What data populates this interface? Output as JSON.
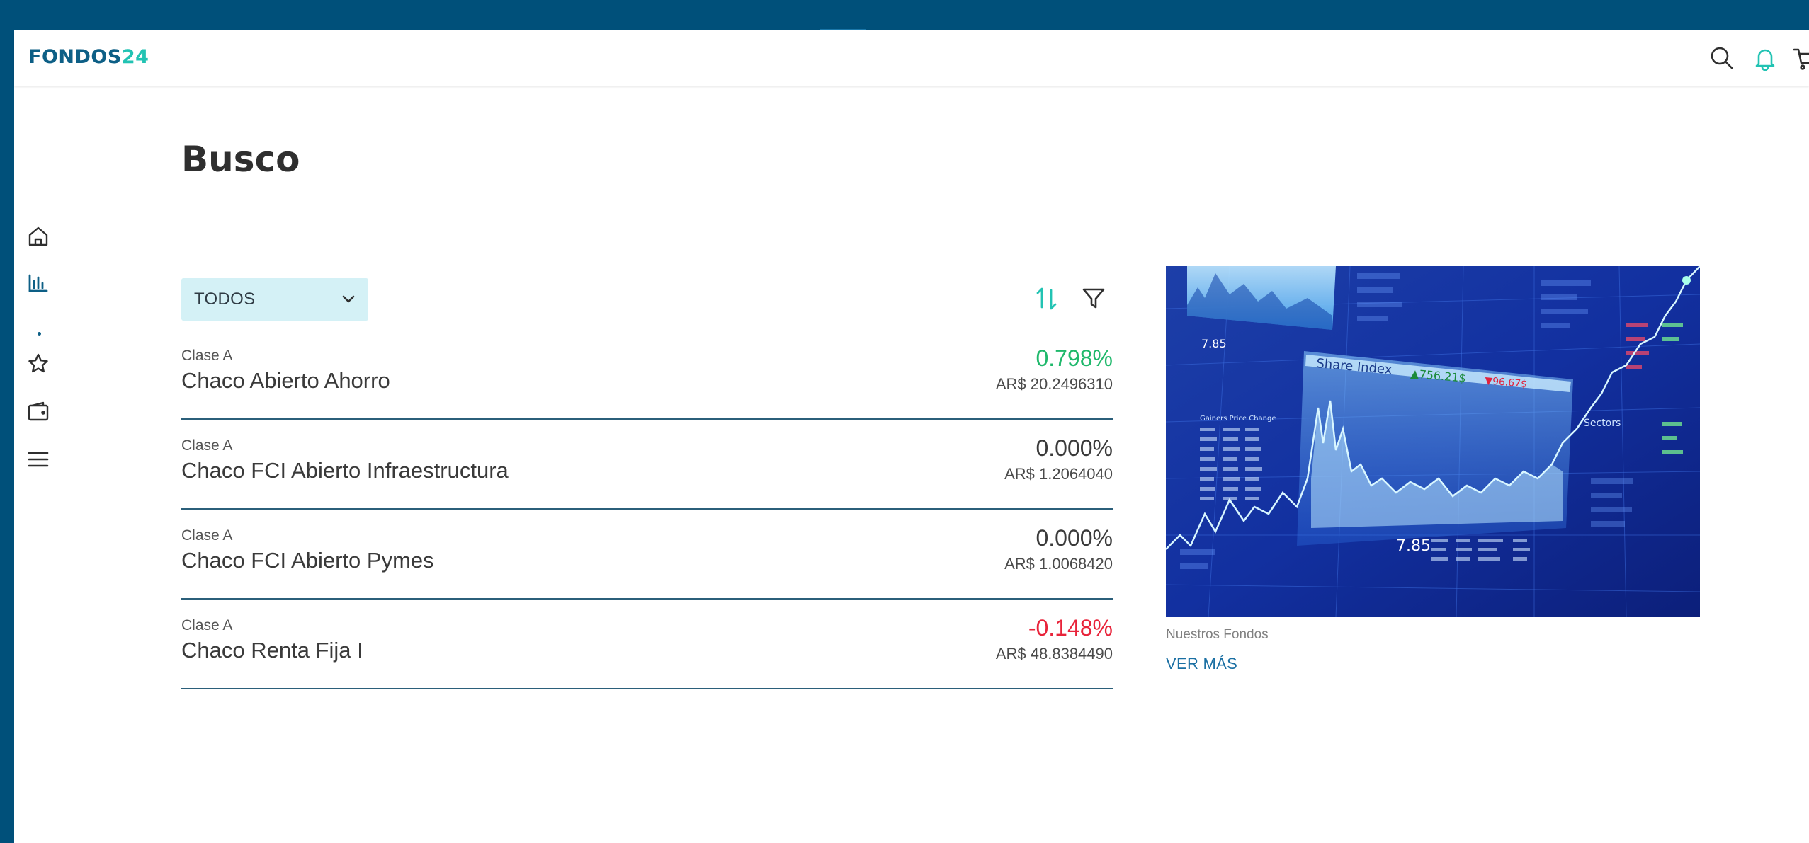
{
  "header": {
    "logo_part1": "FONDOS",
    "logo_part2": "24",
    "icons": [
      "search-icon",
      "bell-icon",
      "cart-icon"
    ]
  },
  "sidebar": {
    "items": [
      {
        "icon": "home-icon",
        "active": false
      },
      {
        "icon": "chart-icon",
        "active": true
      },
      {
        "icon": "star-icon",
        "active": false
      },
      {
        "icon": "wallet-icon",
        "active": false
      },
      {
        "icon": "menu-icon",
        "active": false
      }
    ]
  },
  "main": {
    "title": "Busco",
    "filter": {
      "selected": "TODOS"
    },
    "funds": [
      {
        "class": "Clase A",
        "name": "Chaco Abierto Ahorro",
        "pct": "0.798%",
        "price": "AR$ 20.2496310",
        "trend": "up"
      },
      {
        "class": "Clase A",
        "name": "Chaco FCI Abierto Infraestructura",
        "pct": "0.000%",
        "price": "AR$ 1.2064040",
        "trend": "flat"
      },
      {
        "class": "Clase A",
        "name": "Chaco FCI Abierto Pymes",
        "pct": "0.000%",
        "price": "AR$ 1.0068420",
        "trend": "flat"
      },
      {
        "class": "Clase A",
        "name": "Chaco Renta Fija I",
        "pct": "-0.148%",
        "price": "AR$ 48.8384490",
        "trend": "down"
      }
    ]
  },
  "promo": {
    "caption": "Nuestros Fondos",
    "link_label": "VER MÁS",
    "image_labels": {
      "share_index": "Share Index",
      "index_value": "▲756.21$",
      "index_drop": "▼96.67$",
      "left_value": "7.85",
      "bottom_value": "7.85",
      "sectors": "Sectors",
      "gainers": "Gainers  Price  Change"
    }
  },
  "colors": {
    "frame": "#00507a",
    "accent": "#0d5f86",
    "teal": "#22c3b3",
    "positive": "#1fb86b",
    "negative": "#e8233a",
    "neutral": "#3a3a3a",
    "dropdown_bg": "#d4f1f6",
    "link": "#1a6fa3"
  }
}
